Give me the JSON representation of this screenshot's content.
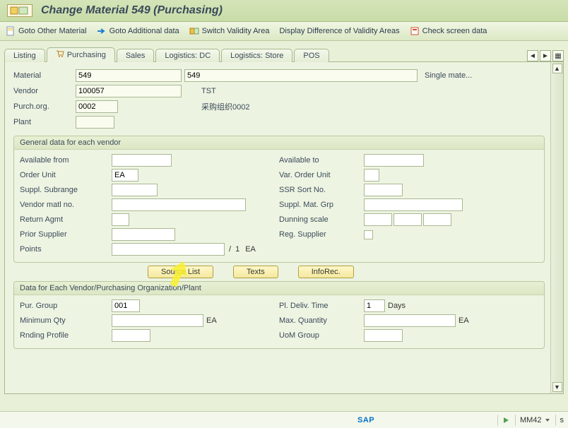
{
  "titlebar": {
    "icon": "form-icon",
    "title": "Change Material 549 (Purchasing)"
  },
  "toolbar": {
    "goto_other": "Goto Other Material",
    "goto_additional": "Goto Additional data",
    "switch_validity": "Switch Validity Area",
    "display_diff": "Display Difference of Validity Areas",
    "check_screen": "Check screen data"
  },
  "tabs": {
    "listing": "Listing",
    "purchasing": "Purchasing",
    "sales": "Sales",
    "logistics_dc": "Logistics: DC",
    "logistics_store": "Logistics: Store",
    "pos": "POS"
  },
  "header": {
    "material_lbl": "Material",
    "material_val": "549",
    "material_desc": "549",
    "material_extra": "Single mate...",
    "vendor_lbl": "Vendor",
    "vendor_val": "100057",
    "vendor_desc": "TST",
    "purchorg_lbl": "Purch.org.",
    "purchorg_val": "0002",
    "purchorg_desc": "采购组织0002",
    "plant_lbl": "Plant",
    "plant_val": ""
  },
  "panel_general": {
    "title": "General data for each vendor",
    "available_from_lbl": "Available from",
    "available_from_val": "",
    "available_to_lbl": "Available to",
    "available_to_val": "",
    "order_unit_lbl": "Order Unit",
    "order_unit_val": "EA",
    "var_order_unit_lbl": "Var. Order Unit",
    "var_order_unit_val": "",
    "suppl_subrange_lbl": "Suppl. Subrange",
    "suppl_subrange_val": "",
    "ssr_sort_lbl": "SSR Sort No.",
    "ssr_sort_val": "",
    "vendor_matl_lbl": "Vendor matl no.",
    "vendor_matl_val": "",
    "suppl_mat_grp_lbl": "Suppl. Mat. Grp",
    "suppl_mat_grp_val": "",
    "return_agmt_lbl": "Return Agmt",
    "return_agmt_val": "",
    "dunning_scale_lbl": "Dunning scale",
    "dunning_a": "",
    "dunning_b": "",
    "dunning_c": "",
    "prior_supplier_lbl": "Prior Supplier",
    "prior_supplier_val": "",
    "reg_supplier_lbl": "Reg. Supplier",
    "points_lbl": "Points",
    "points_val": "",
    "points_sep": "/",
    "points_qty": "1",
    "points_unit": "EA"
  },
  "buttons": {
    "source_list": "Source List",
    "texts": "Texts",
    "info_rec": "InfoRec."
  },
  "panel_vendor_org": {
    "title": "Data for Each Vendor/Purchasing Organization/Plant",
    "pur_group_lbl": "Pur. Group",
    "pur_group_val": "001",
    "pl_deliv_lbl": "Pl. Deliv. Time",
    "pl_deliv_val": "1",
    "pl_deliv_unit": "Days",
    "min_qty_lbl": "Minimum Qty",
    "min_qty_val": "",
    "min_qty_unit": "EA",
    "max_qty_lbl": "Max. Quantity",
    "max_qty_val": "",
    "max_qty_unit": "EA",
    "rnd_profile_lbl": "Rnding Profile",
    "rnd_profile_val": "",
    "uom_group_lbl": "UoM Group",
    "uom_group_val": ""
  },
  "status": {
    "sap": "SAP",
    "tcode": "MM42",
    "seg_arrow": "▼"
  }
}
